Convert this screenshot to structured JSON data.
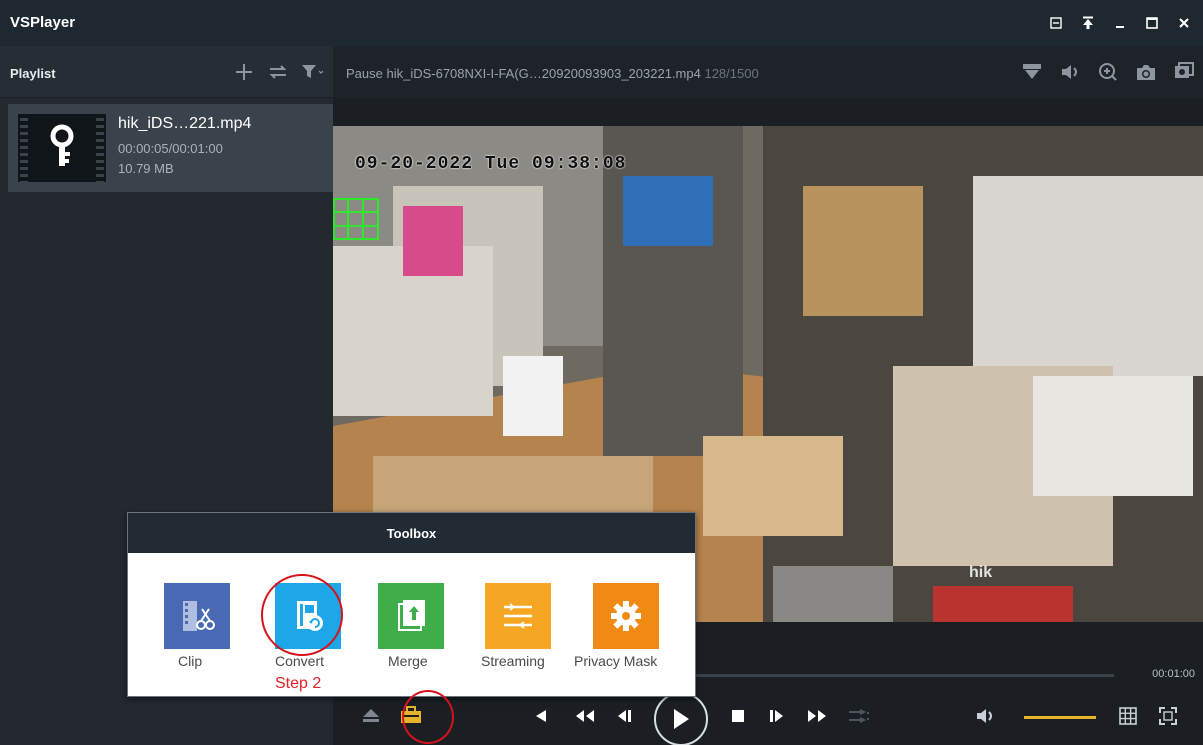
{
  "app": {
    "title": "VSPlayer"
  },
  "window_controls": [
    "minimize-to-tray-icon",
    "pin-icon",
    "minimize-icon",
    "maximize-icon",
    "close-icon"
  ],
  "sidebar": {
    "title": "Playlist",
    "tools": [
      "add-icon",
      "loop-icon",
      "filter-icon"
    ],
    "items": [
      {
        "name": "hik_iDS…221.mp4",
        "time": "00:00:05/00:01:00",
        "size": "10.79 MB"
      }
    ]
  },
  "video_header": {
    "status": "Pause hik_iDS-6708NXI-I-FA(G…20920093903_203221.mp4",
    "frames": "128/1500",
    "tools": [
      "watermark-icon",
      "audio-icon",
      "zoom-icon",
      "snapshot-icon",
      "batch-snapshot-icon"
    ]
  },
  "video": {
    "osd_time": "09-20-2022 Tue 09:38:08",
    "watermark": "hik"
  },
  "playback": {
    "end_time": "00:01:00",
    "volume_level": 0.6,
    "controls": [
      "stop-one-frame-back",
      "slow",
      "prev-frame",
      "play",
      "stop",
      "next-frame",
      "fast",
      "playlist-loop"
    ]
  },
  "toolbox": {
    "title": "Toolbox",
    "tools": [
      {
        "label": "Clip",
        "color": "#4a69b3",
        "icon": "clip-icon"
      },
      {
        "label": "Convert",
        "color": "#1ea7e8",
        "icon": "convert-icon"
      },
      {
        "label": "Merge",
        "color": "#3fae4a",
        "icon": "merge-icon"
      },
      {
        "label": "Streaming",
        "color": "#f5a623",
        "icon": "streaming-icon"
      },
      {
        "label": "Privacy Mask",
        "color": "#f08a14",
        "icon": "gear-icon"
      }
    ],
    "step_label": "Step 2"
  },
  "colors": {
    "accent": "#e5b42a",
    "annotation": "#d7121c"
  }
}
